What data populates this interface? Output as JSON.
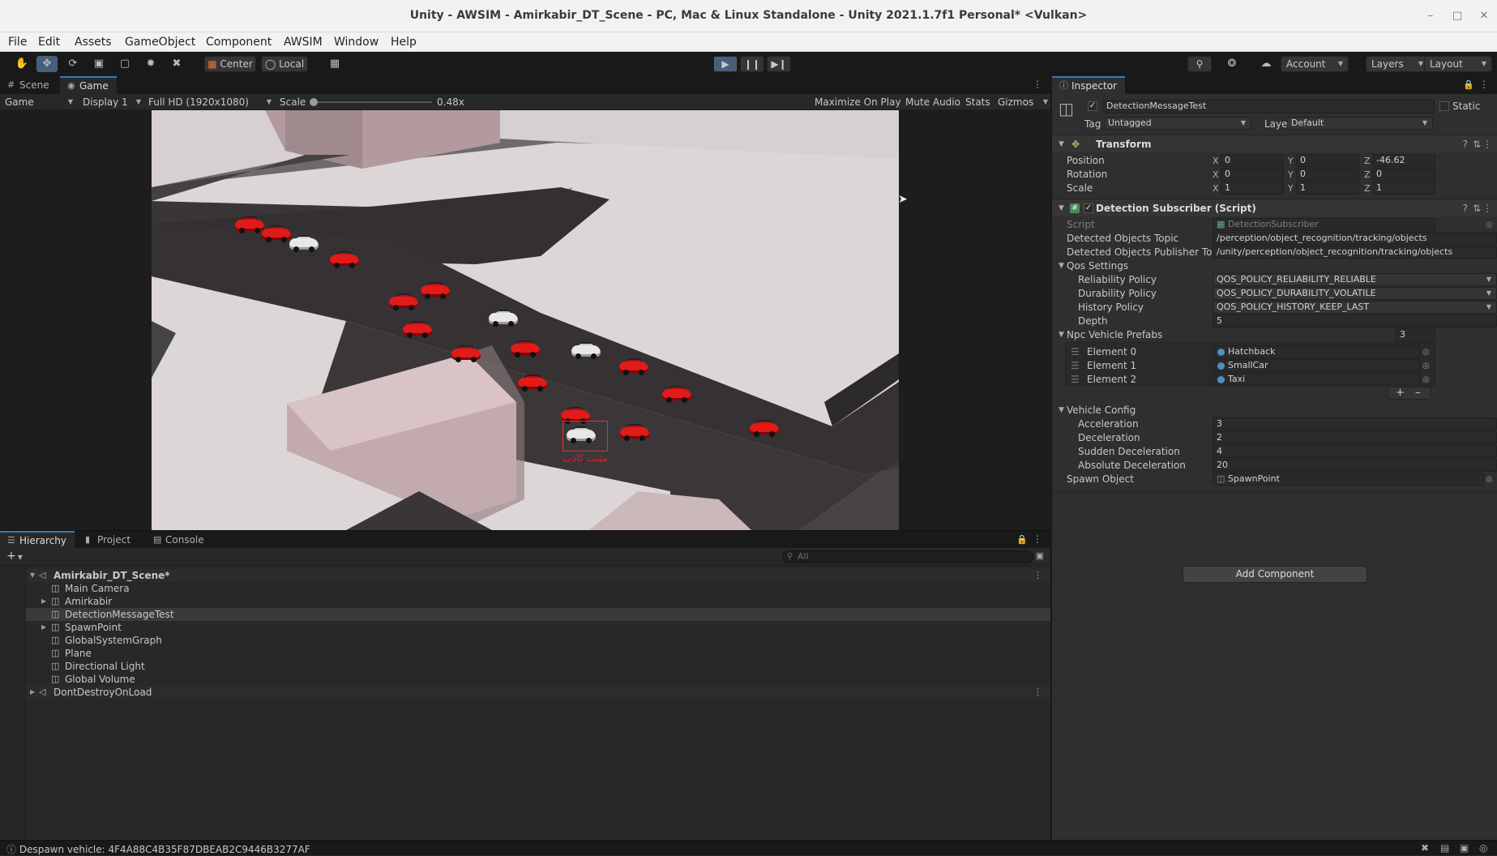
{
  "window": {
    "title": "Unity - AWSIM - Amirkabir_DT_Scene - PC, Mac & Linux Standalone - Unity 2021.1.7f1 Personal* <Vulkan>"
  },
  "menu": [
    "File",
    "Edit",
    "Assets",
    "GameObject",
    "Component",
    "AWSIM",
    "Window",
    "Help"
  ],
  "toolbar": {
    "center_label": "Center",
    "local_label": "Local",
    "account_label": "Account",
    "layers_label": "Layers",
    "layout_label": "Layout"
  },
  "left_tabs": {
    "scene": "Scene",
    "game": "Game"
  },
  "game_controls": {
    "mode": "Game",
    "display": "Display 1",
    "resolution": "Full HD (1920x1080)",
    "scale_label": "Scale",
    "scale_value": "0.48x",
    "maximize": "Maximize On Play",
    "mute": "Mute Audio",
    "stats": "Stats",
    "gizmos": "Gizmos"
  },
  "viewport": {
    "bbox_label": "مثبت کاذب"
  },
  "bottom_tabs": {
    "hierarchy": "Hierarchy",
    "project": "Project",
    "console": "Console"
  },
  "hierarchy": {
    "search_placeholder": "All",
    "scene_name": "Amirkabir_DT_Scene*",
    "items": [
      "Main Camera",
      "Amirkabir",
      "DetectionMessageTest",
      "SpawnPoint",
      "GlobalSystemGraph",
      "Plane",
      "Directional Light",
      "Global Volume"
    ],
    "dont_destroy": "DontDestroyOnLoad"
  },
  "inspector": {
    "tab": "Inspector",
    "object_name": "DetectionMessageTest",
    "static_label": "Static",
    "tag_label": "Tag",
    "tag_value": "Untagged",
    "layer_label": "Layer",
    "layer_value": "Default",
    "transform": {
      "header": "Transform",
      "position_label": "Position",
      "rotation_label": "Rotation",
      "scale_label": "Scale",
      "position": {
        "x": "0",
        "y": "0",
        "z": "-46.62"
      },
      "rotation": {
        "x": "0",
        "y": "0",
        "z": "0"
      },
      "scale": {
        "x": "1",
        "y": "1",
        "z": "1"
      }
    },
    "script_component": {
      "header": "Detection Subscriber (Script)",
      "script_label": "Script",
      "script_value": "DetectionSubscriber",
      "topic_label": "Detected Objects Topic",
      "topic_value": "/perception/object_recognition/tracking/objects",
      "pub_label": "Detected Objects Publisher Topic",
      "pub_value": "/unity/perception/object_recognition/tracking/objects",
      "qos_label": "Qos Settings",
      "reliability_label": "Reliability Policy",
      "reliability_value": "QOS_POLICY_RELIABILITY_RELIABLE",
      "durability_label": "Durability Policy",
      "durability_value": "QOS_POLICY_DURABILITY_VOLATILE",
      "history_label": "History Policy",
      "history_value": "QOS_POLICY_HISTORY_KEEP_LAST",
      "depth_label": "Depth",
      "depth_value": "5",
      "prefabs_label": "Npc Vehicle Prefabs",
      "prefabs_count": "3",
      "elements": [
        {
          "label": "Element 0",
          "value": "Hatchback"
        },
        {
          "label": "Element 1",
          "value": "SmallCar"
        },
        {
          "label": "Element 2",
          "value": "Taxi"
        }
      ],
      "vehicle_config_label": "Vehicle Config",
      "accel_label": "Acceleration",
      "accel_value": "3",
      "decel_label": "Deceleration",
      "decel_value": "2",
      "sudden_label": "Sudden Deceleration",
      "sudden_value": "4",
      "absolute_label": "Absolute Deceleration",
      "absolute_value": "20",
      "spawn_label": "Spawn Object",
      "spawn_value": "SpawnPoint"
    },
    "add_component": "Add Component"
  },
  "status": {
    "message": "Despawn vehicle: 4F4A88C4B35F87DBEAB2C9446B3277AF"
  }
}
